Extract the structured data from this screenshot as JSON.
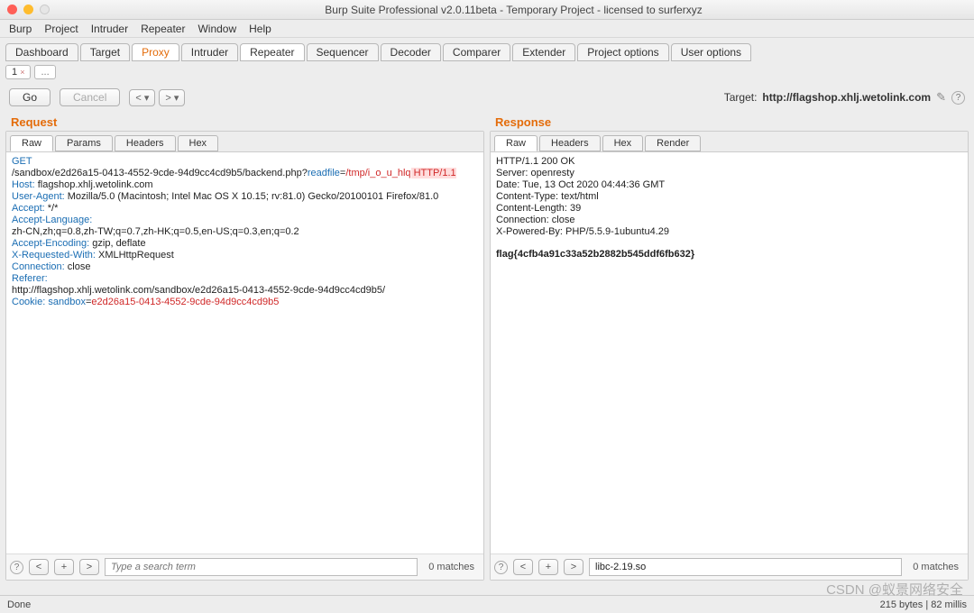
{
  "title": "Burp Suite Professional v2.0.11beta - Temporary Project - licensed to surferxyz",
  "menu": [
    "Burp",
    "Project",
    "Intruder",
    "Repeater",
    "Window",
    "Help"
  ],
  "tabs": [
    "Dashboard",
    "Target",
    "Proxy",
    "Intruder",
    "Repeater",
    "Sequencer",
    "Decoder",
    "Comparer",
    "Extender",
    "Project options",
    "User options"
  ],
  "tabs_active": "Proxy",
  "active_top": "Repeater",
  "subtab_label": "1",
  "subtab_dots": "...",
  "go_label": "Go",
  "cancel_label": "Cancel",
  "nav_prev": "<  ▾",
  "nav_next": ">  ▾",
  "target_prefix": "Target: ",
  "target_url": "http://flagshop.xhlj.wetolink.com",
  "request_title": "Request",
  "response_title": "Response",
  "req_tabs": [
    "Raw",
    "Params",
    "Headers",
    "Hex"
  ],
  "resp_tabs": [
    "Raw",
    "Headers",
    "Hex",
    "Render"
  ],
  "req": {
    "method": "GET",
    "path_pre": "/sandbox/e2d26a15-0413-4552-9cde-94d9cc4cd9b5/backend.php?",
    "qk": "readfile",
    "qeq": "=",
    "qv": "/tmp/i_o_u_hlq",
    "httpver": " HTTP/1.1",
    "h_host_k": "Host:",
    "h_host_v": " flagshop.xhlj.wetolink.com",
    "h_ua_k": "User-Agent:",
    "h_ua_v": " Mozilla/5.0 (Macintosh; Intel Mac OS X 10.15; rv:81.0) Gecko/20100101 Firefox/81.0",
    "h_acc_k": "Accept:",
    "h_acc_v": " */*",
    "h_al_k": "Accept-Language:",
    "h_al_v": "",
    "h_al2": "zh-CN,zh;q=0.8,zh-TW;q=0.7,zh-HK;q=0.5,en-US;q=0.3,en;q=0.2",
    "h_ae_k": "Accept-Encoding:",
    "h_ae_v": " gzip, deflate",
    "h_xrw_k": "X-Requested-With:",
    "h_xrw_v": " XMLHttpRequest",
    "h_conn_k": "Connection:",
    "h_conn_v": " close",
    "h_ref_k": "Referer:",
    "h_ref_v": "",
    "h_ref2": "http://flagshop.xhlj.wetolink.com/sandbox/e2d26a15-0413-4552-9cde-94d9cc4cd9b5/",
    "h_cookie_k": "Cookie: ",
    "h_cookie_nk": "sandbox",
    "h_cookie_eq": "=",
    "h_cookie_nv": "e2d26a15-0413-4552-9cde-94d9cc4cd9b5"
  },
  "resp": {
    "l1": "HTTP/1.1 200 OK",
    "l2": "Server: openresty",
    "l3": "Date: Tue, 13 Oct 2020 04:44:36 GMT",
    "l4": "Content-Type: text/html",
    "l5": "Content-Length: 39",
    "l6": "Connection: close",
    "l7": "X-Powered-By: PHP/5.5.9-1ubuntu4.29",
    "flag": "flag{4cfb4a91c33a52b2882b545ddf6fb632}"
  },
  "search_placeholder": "Type a search term",
  "search2_value": "libc-2.19.so",
  "matches_text": "0 matches",
  "status_left": "Done",
  "status_right": "215 bytes | 82 millis",
  "watermark": "CSDN @蚁景网络安全",
  "icons": {
    "question": "?",
    "plus": "+",
    "lt": "<",
    "gt": ">",
    "pencil": "✎"
  }
}
